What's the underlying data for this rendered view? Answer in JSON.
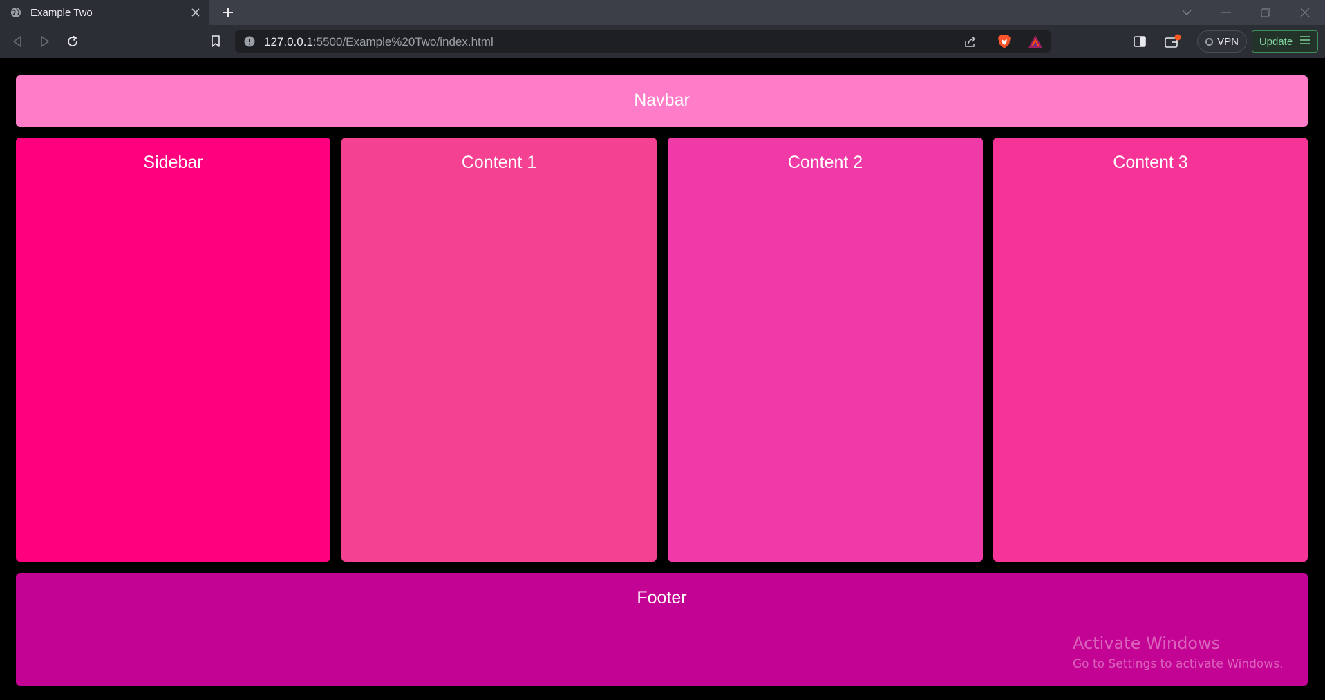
{
  "browser": {
    "tab": {
      "title": "Example Two",
      "favicon_icon": "globe-icon"
    },
    "url": {
      "host": "127.0.0.1",
      "path": ":5500/Example%20Two/index.html"
    },
    "vpn_label": "VPN",
    "update_label": "Update",
    "colors": {
      "tabbar": "#3c3f47",
      "toolbar": "#2b2e35",
      "urlbar": "#1d1f23",
      "update_accent": "#7fd39b",
      "notification_badge": "#ff5722"
    }
  },
  "page": {
    "navbar": {
      "label": "Navbar",
      "color": "#ff7cc8"
    },
    "sidebar": {
      "label": "Sidebar",
      "color": "#ff007f"
    },
    "contents": [
      {
        "label": "Content 1",
        "color": "#f44192"
      },
      {
        "label": "Content 2",
        "color": "#f03aa8"
      },
      {
        "label": "Content 3",
        "color": "#f63497"
      }
    ],
    "footer": {
      "label": "Footer",
      "color": "#c30393"
    }
  },
  "os_watermark": {
    "title": "Activate Windows",
    "subtitle": "Go to Settings to activate Windows."
  }
}
